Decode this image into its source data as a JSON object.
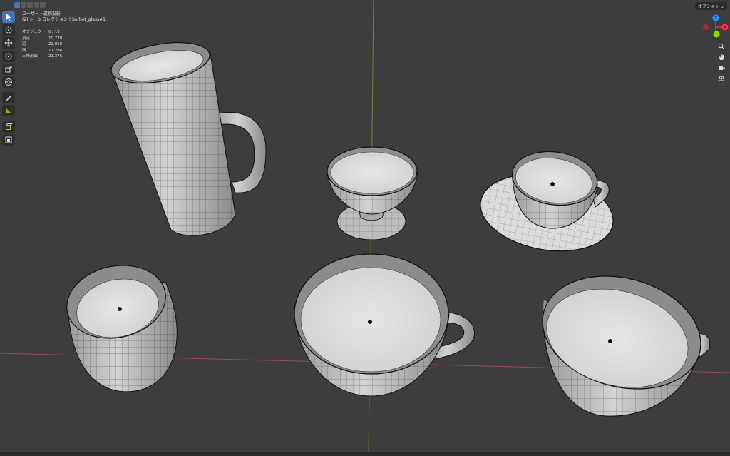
{
  "header": {
    "view_name": "ユーザー・透視投影",
    "collection": "(2) シーンコレクション | Sorbet_glass#1",
    "options_label": "オプション ⌄"
  },
  "stats": [
    {
      "label": "オブジェクト",
      "value": "0 / 12"
    },
    {
      "label": "頂点",
      "value": "10,778"
    },
    {
      "label": "辺",
      "value": "22,050"
    },
    {
      "label": "面",
      "value": "11,284"
    },
    {
      "label": "三角形面",
      "value": "21,376"
    }
  ],
  "gizmo": {
    "z": "Z",
    "x": "X",
    "y": "Y"
  },
  "colors": {
    "background": "#3d3d3d",
    "accent": "#4772b3",
    "axis_x": "#ff3352",
    "axis_y": "#8bdc00",
    "axis_z": "#2890ff",
    "mesh_fill": "#c9c9c9",
    "wire": "#1a1a1a"
  },
  "icons": [
    "select-box-icon",
    "cursor-icon",
    "move-icon",
    "rotate-icon",
    "scale-icon",
    "transform-icon",
    "annotate-icon",
    "measure-icon",
    "add-cube-icon",
    "add-object-icon",
    "zoom-icon",
    "pan-hand-icon",
    "camera-icon",
    "grid-view-icon"
  ]
}
